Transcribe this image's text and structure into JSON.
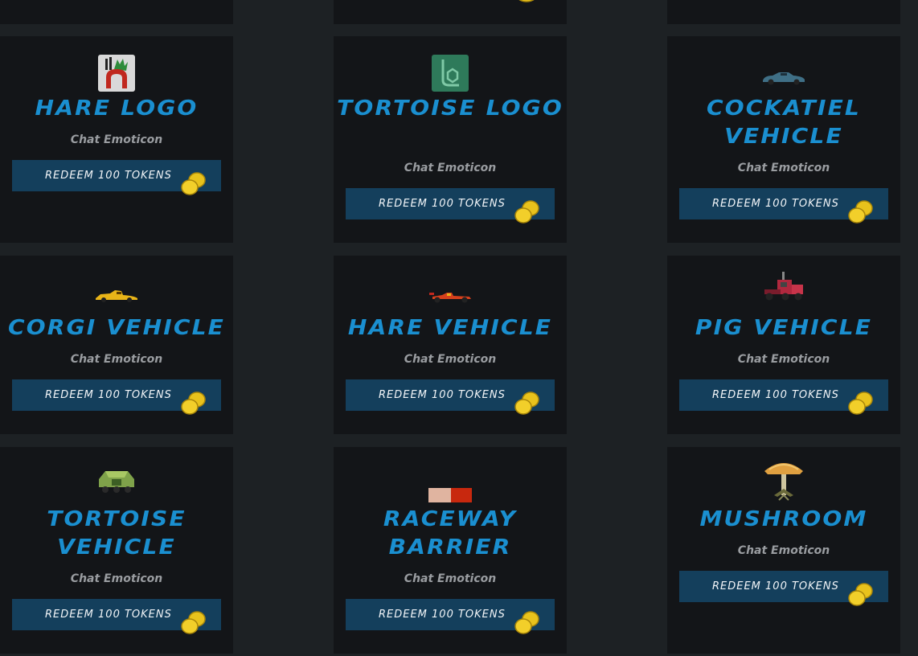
{
  "colors": {
    "page_bg": "#1d2124",
    "card_bg": "#131518",
    "title": "#1a8fd0",
    "subtitle": "#9a9da1",
    "button_bg": "#143f5c",
    "coin": "#e8c21c"
  },
  "cards": [
    {
      "title": "HARE LOGO",
      "subtitle": "Chat Emoticon",
      "button": "REDEEM 100 TOKENS",
      "icon": "hare-logo-icon"
    },
    {
      "title": "TORTOISE LOGO",
      "subtitle": "Chat Emoticon",
      "button": "REDEEM 100 TOKENS",
      "icon": "tortoise-logo-icon"
    },
    {
      "title": "COCKATIEL VEHICLE",
      "subtitle": "Chat Emoticon",
      "button": "REDEEM 100 TOKENS",
      "icon": "cockatiel-car-icon"
    },
    {
      "title": "CORGI VEHICLE",
      "subtitle": "Chat Emoticon",
      "button": "REDEEM 100 TOKENS",
      "icon": "corgi-car-icon"
    },
    {
      "title": "HARE VEHICLE",
      "subtitle": "Chat Emoticon",
      "button": "REDEEM 100 TOKENS",
      "icon": "hare-racecar-icon"
    },
    {
      "title": "PIG VEHICLE",
      "subtitle": "Chat Emoticon",
      "button": "REDEEM 100 TOKENS",
      "icon": "pig-truck-icon"
    },
    {
      "title": "TORTOISE VEHICLE",
      "subtitle": "Chat Emoticon",
      "button": "REDEEM 100 TOKENS",
      "icon": "tortoise-tank-icon"
    },
    {
      "title": "RACEWAY BARRIER",
      "subtitle": "Chat Emoticon",
      "button": "REDEEM 100 TOKENS",
      "icon": "raceway-barrier-icon"
    },
    {
      "title": "MUSHROOM",
      "subtitle": "Chat Emoticon",
      "button": "REDEEM 100 TOKENS",
      "icon": "mushroom-icon"
    }
  ]
}
